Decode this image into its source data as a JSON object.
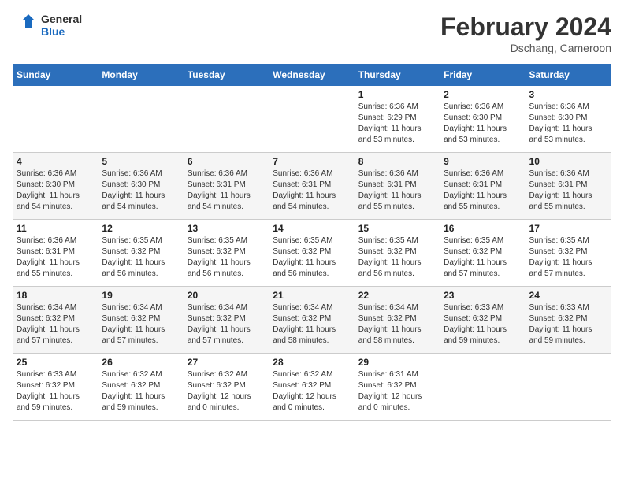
{
  "header": {
    "logo_line1": "General",
    "logo_line2": "Blue",
    "month_year": "February 2024",
    "location": "Dschang, Cameroon"
  },
  "days_of_week": [
    "Sunday",
    "Monday",
    "Tuesday",
    "Wednesday",
    "Thursday",
    "Friday",
    "Saturday"
  ],
  "weeks": [
    [
      {
        "day": "",
        "info": ""
      },
      {
        "day": "",
        "info": ""
      },
      {
        "day": "",
        "info": ""
      },
      {
        "day": "",
        "info": ""
      },
      {
        "day": "1",
        "info": "Sunrise: 6:36 AM\nSunset: 6:29 PM\nDaylight: 11 hours\nand 53 minutes."
      },
      {
        "day": "2",
        "info": "Sunrise: 6:36 AM\nSunset: 6:30 PM\nDaylight: 11 hours\nand 53 minutes."
      },
      {
        "day": "3",
        "info": "Sunrise: 6:36 AM\nSunset: 6:30 PM\nDaylight: 11 hours\nand 53 minutes."
      }
    ],
    [
      {
        "day": "4",
        "info": "Sunrise: 6:36 AM\nSunset: 6:30 PM\nDaylight: 11 hours\nand 54 minutes."
      },
      {
        "day": "5",
        "info": "Sunrise: 6:36 AM\nSunset: 6:30 PM\nDaylight: 11 hours\nand 54 minutes."
      },
      {
        "day": "6",
        "info": "Sunrise: 6:36 AM\nSunset: 6:31 PM\nDaylight: 11 hours\nand 54 minutes."
      },
      {
        "day": "7",
        "info": "Sunrise: 6:36 AM\nSunset: 6:31 PM\nDaylight: 11 hours\nand 54 minutes."
      },
      {
        "day": "8",
        "info": "Sunrise: 6:36 AM\nSunset: 6:31 PM\nDaylight: 11 hours\nand 55 minutes."
      },
      {
        "day": "9",
        "info": "Sunrise: 6:36 AM\nSunset: 6:31 PM\nDaylight: 11 hours\nand 55 minutes."
      },
      {
        "day": "10",
        "info": "Sunrise: 6:36 AM\nSunset: 6:31 PM\nDaylight: 11 hours\nand 55 minutes."
      }
    ],
    [
      {
        "day": "11",
        "info": "Sunrise: 6:36 AM\nSunset: 6:31 PM\nDaylight: 11 hours\nand 55 minutes."
      },
      {
        "day": "12",
        "info": "Sunrise: 6:35 AM\nSunset: 6:32 PM\nDaylight: 11 hours\nand 56 minutes."
      },
      {
        "day": "13",
        "info": "Sunrise: 6:35 AM\nSunset: 6:32 PM\nDaylight: 11 hours\nand 56 minutes."
      },
      {
        "day": "14",
        "info": "Sunrise: 6:35 AM\nSunset: 6:32 PM\nDaylight: 11 hours\nand 56 minutes."
      },
      {
        "day": "15",
        "info": "Sunrise: 6:35 AM\nSunset: 6:32 PM\nDaylight: 11 hours\nand 56 minutes."
      },
      {
        "day": "16",
        "info": "Sunrise: 6:35 AM\nSunset: 6:32 PM\nDaylight: 11 hours\nand 57 minutes."
      },
      {
        "day": "17",
        "info": "Sunrise: 6:35 AM\nSunset: 6:32 PM\nDaylight: 11 hours\nand 57 minutes."
      }
    ],
    [
      {
        "day": "18",
        "info": "Sunrise: 6:34 AM\nSunset: 6:32 PM\nDaylight: 11 hours\nand 57 minutes."
      },
      {
        "day": "19",
        "info": "Sunrise: 6:34 AM\nSunset: 6:32 PM\nDaylight: 11 hours\nand 57 minutes."
      },
      {
        "day": "20",
        "info": "Sunrise: 6:34 AM\nSunset: 6:32 PM\nDaylight: 11 hours\nand 57 minutes."
      },
      {
        "day": "21",
        "info": "Sunrise: 6:34 AM\nSunset: 6:32 PM\nDaylight: 11 hours\nand 58 minutes."
      },
      {
        "day": "22",
        "info": "Sunrise: 6:34 AM\nSunset: 6:32 PM\nDaylight: 11 hours\nand 58 minutes."
      },
      {
        "day": "23",
        "info": "Sunrise: 6:33 AM\nSunset: 6:32 PM\nDaylight: 11 hours\nand 59 minutes."
      },
      {
        "day": "24",
        "info": "Sunrise: 6:33 AM\nSunset: 6:32 PM\nDaylight: 11 hours\nand 59 minutes."
      }
    ],
    [
      {
        "day": "25",
        "info": "Sunrise: 6:33 AM\nSunset: 6:32 PM\nDaylight: 11 hours\nand 59 minutes."
      },
      {
        "day": "26",
        "info": "Sunrise: 6:32 AM\nSunset: 6:32 PM\nDaylight: 11 hours\nand 59 minutes."
      },
      {
        "day": "27",
        "info": "Sunrise: 6:32 AM\nSunset: 6:32 PM\nDaylight: 12 hours\nand 0 minutes."
      },
      {
        "day": "28",
        "info": "Sunrise: 6:32 AM\nSunset: 6:32 PM\nDaylight: 12 hours\nand 0 minutes."
      },
      {
        "day": "29",
        "info": "Sunrise: 6:31 AM\nSunset: 6:32 PM\nDaylight: 12 hours\nand 0 minutes."
      },
      {
        "day": "",
        "info": ""
      },
      {
        "day": "",
        "info": ""
      }
    ]
  ]
}
